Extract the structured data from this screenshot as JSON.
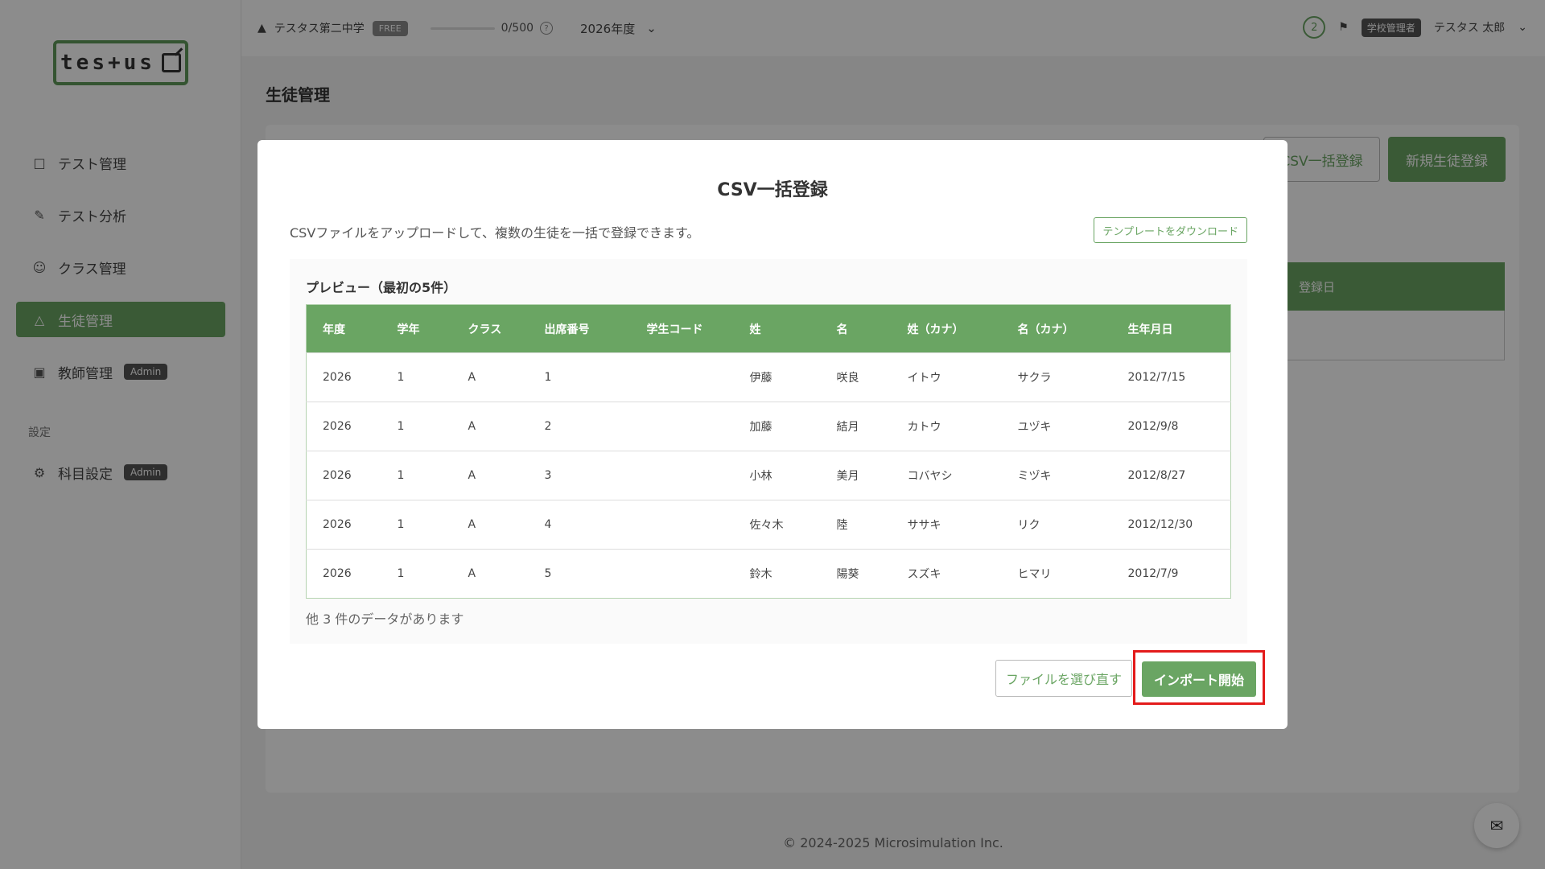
{
  "sidebar": {
    "logo_text": "tes+us",
    "items": [
      {
        "label": "テスト管理",
        "icon": "document-icon"
      },
      {
        "label": "テスト分析",
        "icon": "analysis-icon"
      },
      {
        "label": "クラス管理",
        "icon": "group-icon"
      },
      {
        "label": "生徒管理",
        "icon": "student-icon"
      },
      {
        "label": "教師管理",
        "icon": "teacher-icon",
        "badge": "Admin"
      }
    ],
    "section_label": "設定",
    "settings_items": [
      {
        "label": "科目設定",
        "icon": "gear-icon",
        "badge": "Admin"
      }
    ]
  },
  "topbar": {
    "school_name": "テスタス第二中学",
    "plan_badge": "FREE",
    "usage": "0/500",
    "usage_fraction": 0.0,
    "year": "2026年度",
    "notification_count": "2",
    "role_badge": "学校管理者",
    "user_name": "テスタス 太郎"
  },
  "page": {
    "title": "生徒管理",
    "csv_button": "CSV一括登録",
    "new_button": "新規生徒登録",
    "table_header_date": "登録日"
  },
  "modal": {
    "title": "CSV一括登録",
    "description": "CSVファイルをアップロードして、複数の生徒を一括で登録できます。",
    "template_button": "テンプレートをダウンロード",
    "preview_label": "プレビュー（最初の5件）",
    "columns": [
      "年度",
      "学年",
      "クラス",
      "出席番号",
      "学生コード",
      "姓",
      "名",
      "姓（カナ）",
      "名（カナ）",
      "生年月日"
    ],
    "rows": [
      [
        "2026",
        "1",
        "A",
        "1",
        "",
        "伊藤",
        "咲良",
        "イトウ",
        "サクラ",
        "2012/7/15"
      ],
      [
        "2026",
        "1",
        "A",
        "2",
        "",
        "加藤",
        "結月",
        "カトウ",
        "ユヅキ",
        "2012/9/8"
      ],
      [
        "2026",
        "1",
        "A",
        "3",
        "",
        "小林",
        "美月",
        "コバヤシ",
        "ミヅキ",
        "2012/8/27"
      ],
      [
        "2026",
        "1",
        "A",
        "4",
        "",
        "佐々木",
        "陸",
        "ササキ",
        "リク",
        "2012/12/30"
      ],
      [
        "2026",
        "1",
        "A",
        "5",
        "",
        "鈴木",
        "陽葵",
        "スズキ",
        "ヒマリ",
        "2012/7/9"
      ]
    ],
    "more_text": "他 3 件のデータがあります",
    "reselect_button": "ファイルを選び直す",
    "import_button": "インポート開始"
  },
  "footer": {
    "copyright": "© 2024-2025 Microsimulation Inc."
  },
  "colors": {
    "accent": "#6aa563",
    "highlight": "#e31b1b"
  }
}
